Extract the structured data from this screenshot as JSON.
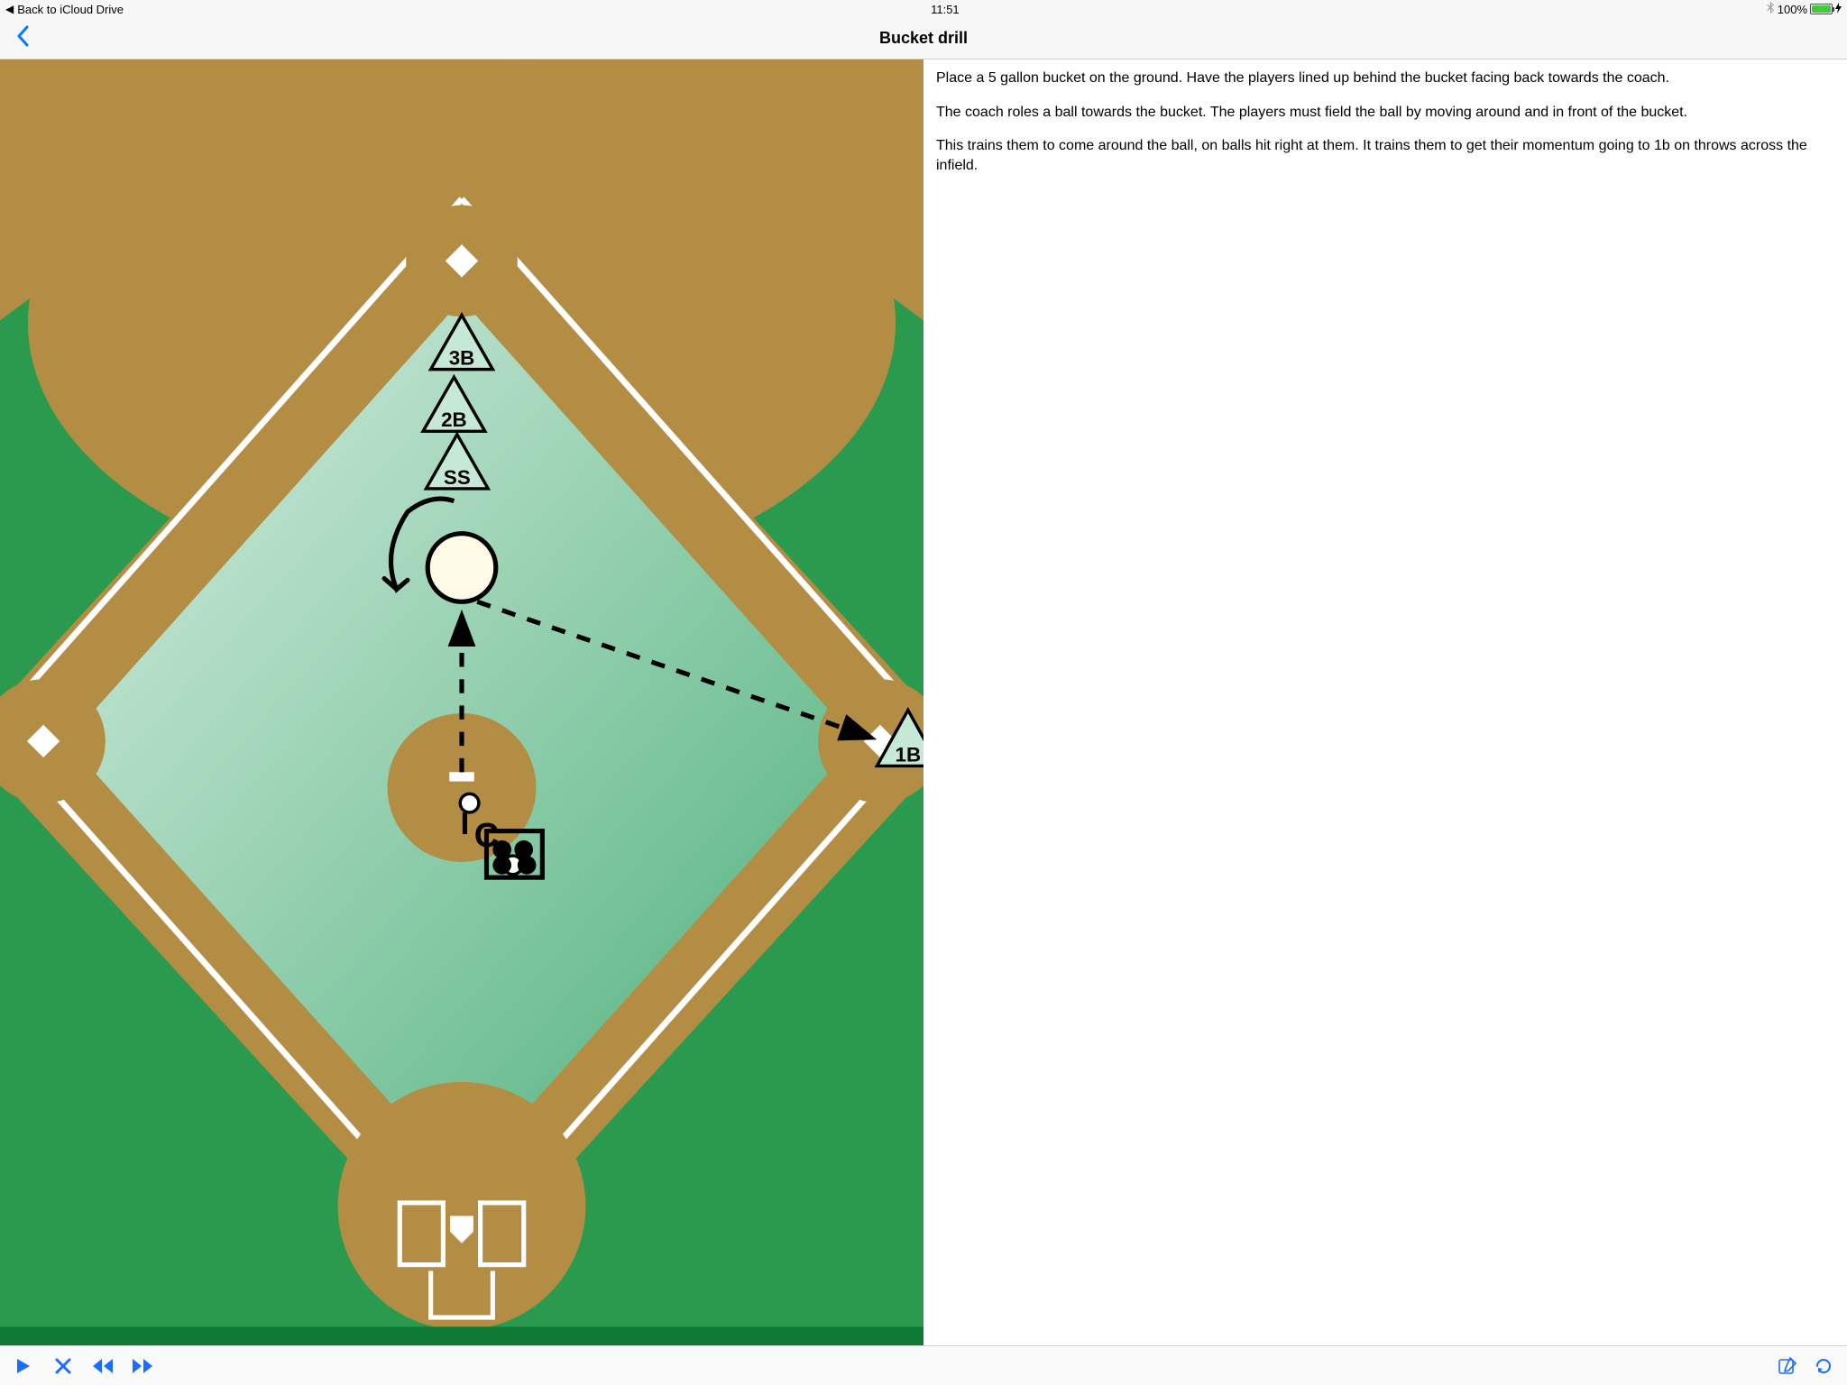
{
  "status": {
    "back_to": "Back to iCloud Drive",
    "time": "11:51",
    "battery_pct": "100%"
  },
  "nav": {
    "title": "Bucket drill"
  },
  "description": {
    "p1": "Place a 5 gallon bucket on the ground. Have the players lined up behind the bucket facing back towards the coach.",
    "p2": "The coach roles a ball towards the bucket. The players must field the ball by moving around and in front of the bucket.",
    "p3": "This trains them to come around the ball, on balls hit right at them. It trains them to get their momentum going to 1b on throws across the infield."
  },
  "diagram": {
    "players": {
      "third_base": "3B",
      "second_base": "2B",
      "shortstop": "SS",
      "first_base": "1B",
      "coach": "C"
    }
  },
  "colors": {
    "ios_blue": "#1a6eff",
    "field_green_dark": "#1f9c4e",
    "field_green_light": "#a9d8bc",
    "dirt": "#b28d43",
    "player_fill": "#c6e9d7"
  }
}
